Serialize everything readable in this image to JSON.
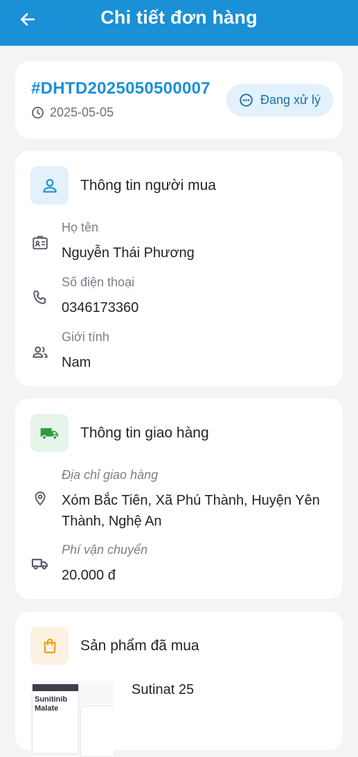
{
  "header": {
    "title": "Chi tiết đơn hàng",
    "back_icon": "arrow-left-icon",
    "background": "#1a90d6"
  },
  "order": {
    "code": "#DHTD2025050500007",
    "date": "2025-05-05",
    "status": "Đang xử lý",
    "status_color": "#1a6fa8",
    "status_bg": "#e2f1fb"
  },
  "buyer": {
    "title": "Thông tin người mua",
    "fields": [
      {
        "label": "Họ tên",
        "value": "Nguyễn Thái Phương",
        "icon": "id-card-icon"
      },
      {
        "label": "Số điện thoại",
        "value": "0346173360",
        "icon": "phone-icon"
      },
      {
        "label": "Giới tính",
        "value": "Nam",
        "icon": "people-icon"
      }
    ]
  },
  "shipping": {
    "title": "Thông tin giao hàng",
    "fields": [
      {
        "label": "Địa chỉ giao hàng",
        "value": "Xóm Bắc Tiên, Xã Phú Thành, Huyện Yên Thành, Nghệ An",
        "icon": "location-pin-icon"
      },
      {
        "label": "Phí vận chuyển",
        "value": "20.000 đ",
        "icon": "truck-icon"
      }
    ]
  },
  "products": {
    "title": "Sản phẩm đã mua",
    "items": [
      {
        "name": "Sutinat 25",
        "thumb_text": "Sunitinib Malate"
      }
    ]
  }
}
